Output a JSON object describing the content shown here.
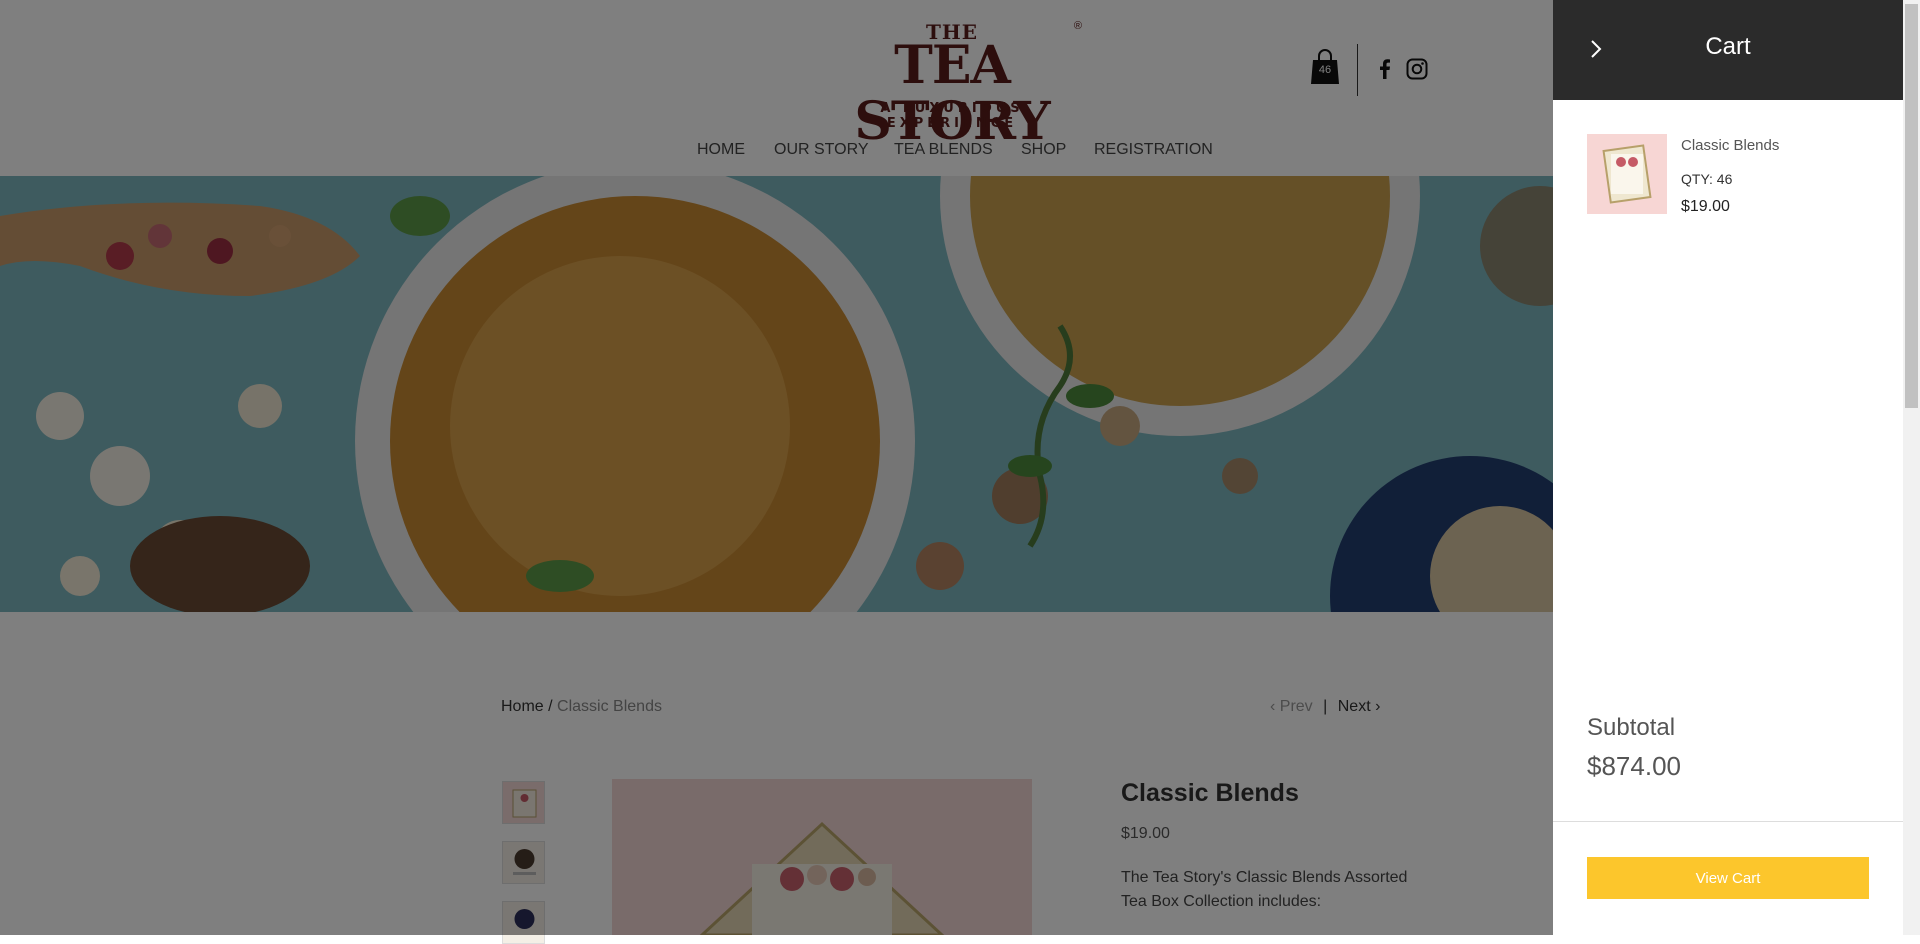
{
  "brand": {
    "the": "THE",
    "name": "TEA STORY",
    "registered": "®",
    "tagline": "A LUXURIOUS EXPERIENCE"
  },
  "header": {
    "cart_count": "46",
    "social": [
      "facebook-icon",
      "instagram-icon"
    ]
  },
  "nav": [
    {
      "label": "HOME"
    },
    {
      "label": "OUR STORY"
    },
    {
      "label": "TEA BLENDS"
    },
    {
      "label": "SHOP"
    },
    {
      "label": "REGISTRATION"
    }
  ],
  "breadcrumb": {
    "home": "Home",
    "separator": "/",
    "current": "Classic Blends"
  },
  "pager": {
    "prev": "Prev",
    "divider": "|",
    "next": "Next"
  },
  "product": {
    "title": "Classic Blends",
    "price": "$19.00",
    "description": "The Tea Story's Classic Blends Assorted Tea Box Collection includes:"
  },
  "cart": {
    "title": "Cart",
    "item": {
      "name": "Classic Blends",
      "qty": "QTY: 46",
      "price": "$19.00"
    },
    "subtotal_label": "Subtotal",
    "subtotal_value": "$874.00",
    "view_cart_label": "View Cart"
  },
  "colors": {
    "overlay": "#000000",
    "cart_header": "#2b2b2b",
    "accent_button": "#fcc62c",
    "brand": "#5a1d1a",
    "hero_bg": "#7fb8c0",
    "product_bg": "#f5d8d6"
  }
}
